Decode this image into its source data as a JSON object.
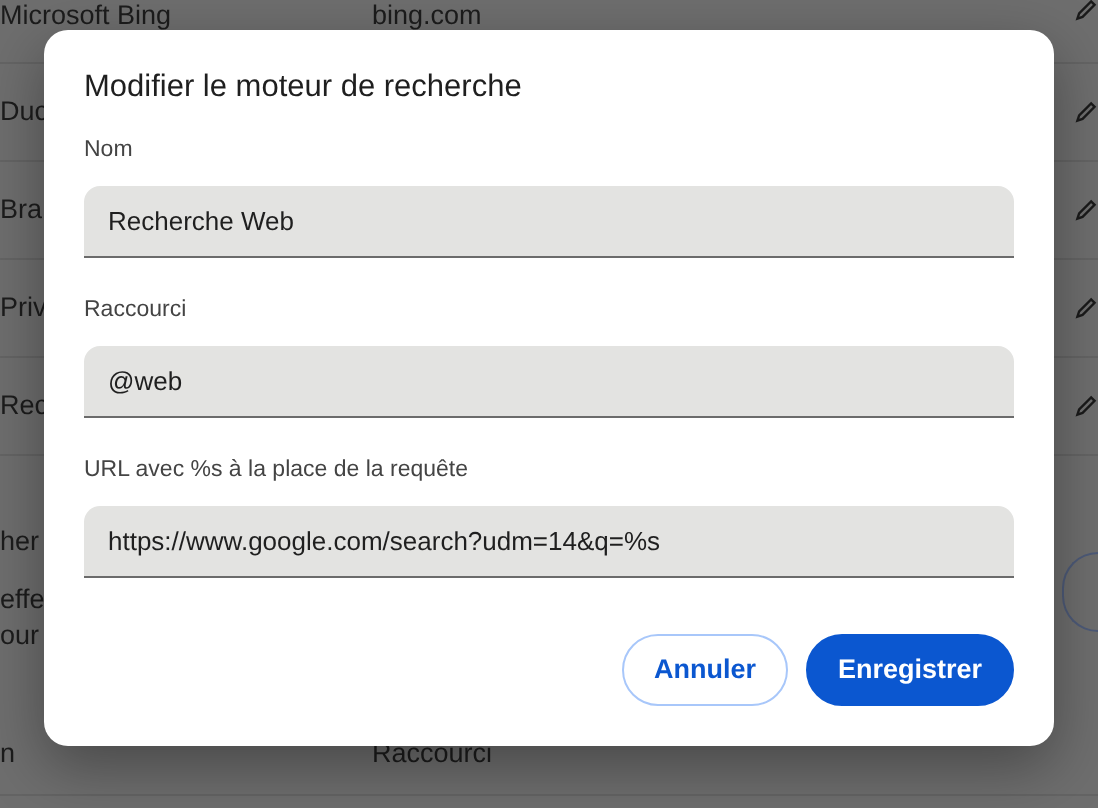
{
  "background": {
    "engines": [
      {
        "name": "Microsoft Bing",
        "shortcut": "bing.com"
      },
      {
        "name": "Duc"
      },
      {
        "name": "Bra"
      },
      {
        "name": "Priv"
      },
      {
        "name": "Rec"
      }
    ],
    "section_lines": [
      "her",
      "effe",
      "our"
    ],
    "footer_row": {
      "column_1": "n",
      "column_2": "Raccourci"
    }
  },
  "dialog": {
    "title": "Modifier le moteur de recherche",
    "fields": [
      {
        "label": "Nom",
        "value": "Recherche Web"
      },
      {
        "label": "Raccourci",
        "value": "@web"
      },
      {
        "label": "URL avec %s à la place de la requête",
        "value": "https://www.google.com/search?udm=14&q=%s"
      }
    ],
    "buttons": [
      {
        "label": "Annuler",
        "kind": "secondary"
      },
      {
        "label": "Enregistrer",
        "kind": "primary"
      }
    ]
  }
}
